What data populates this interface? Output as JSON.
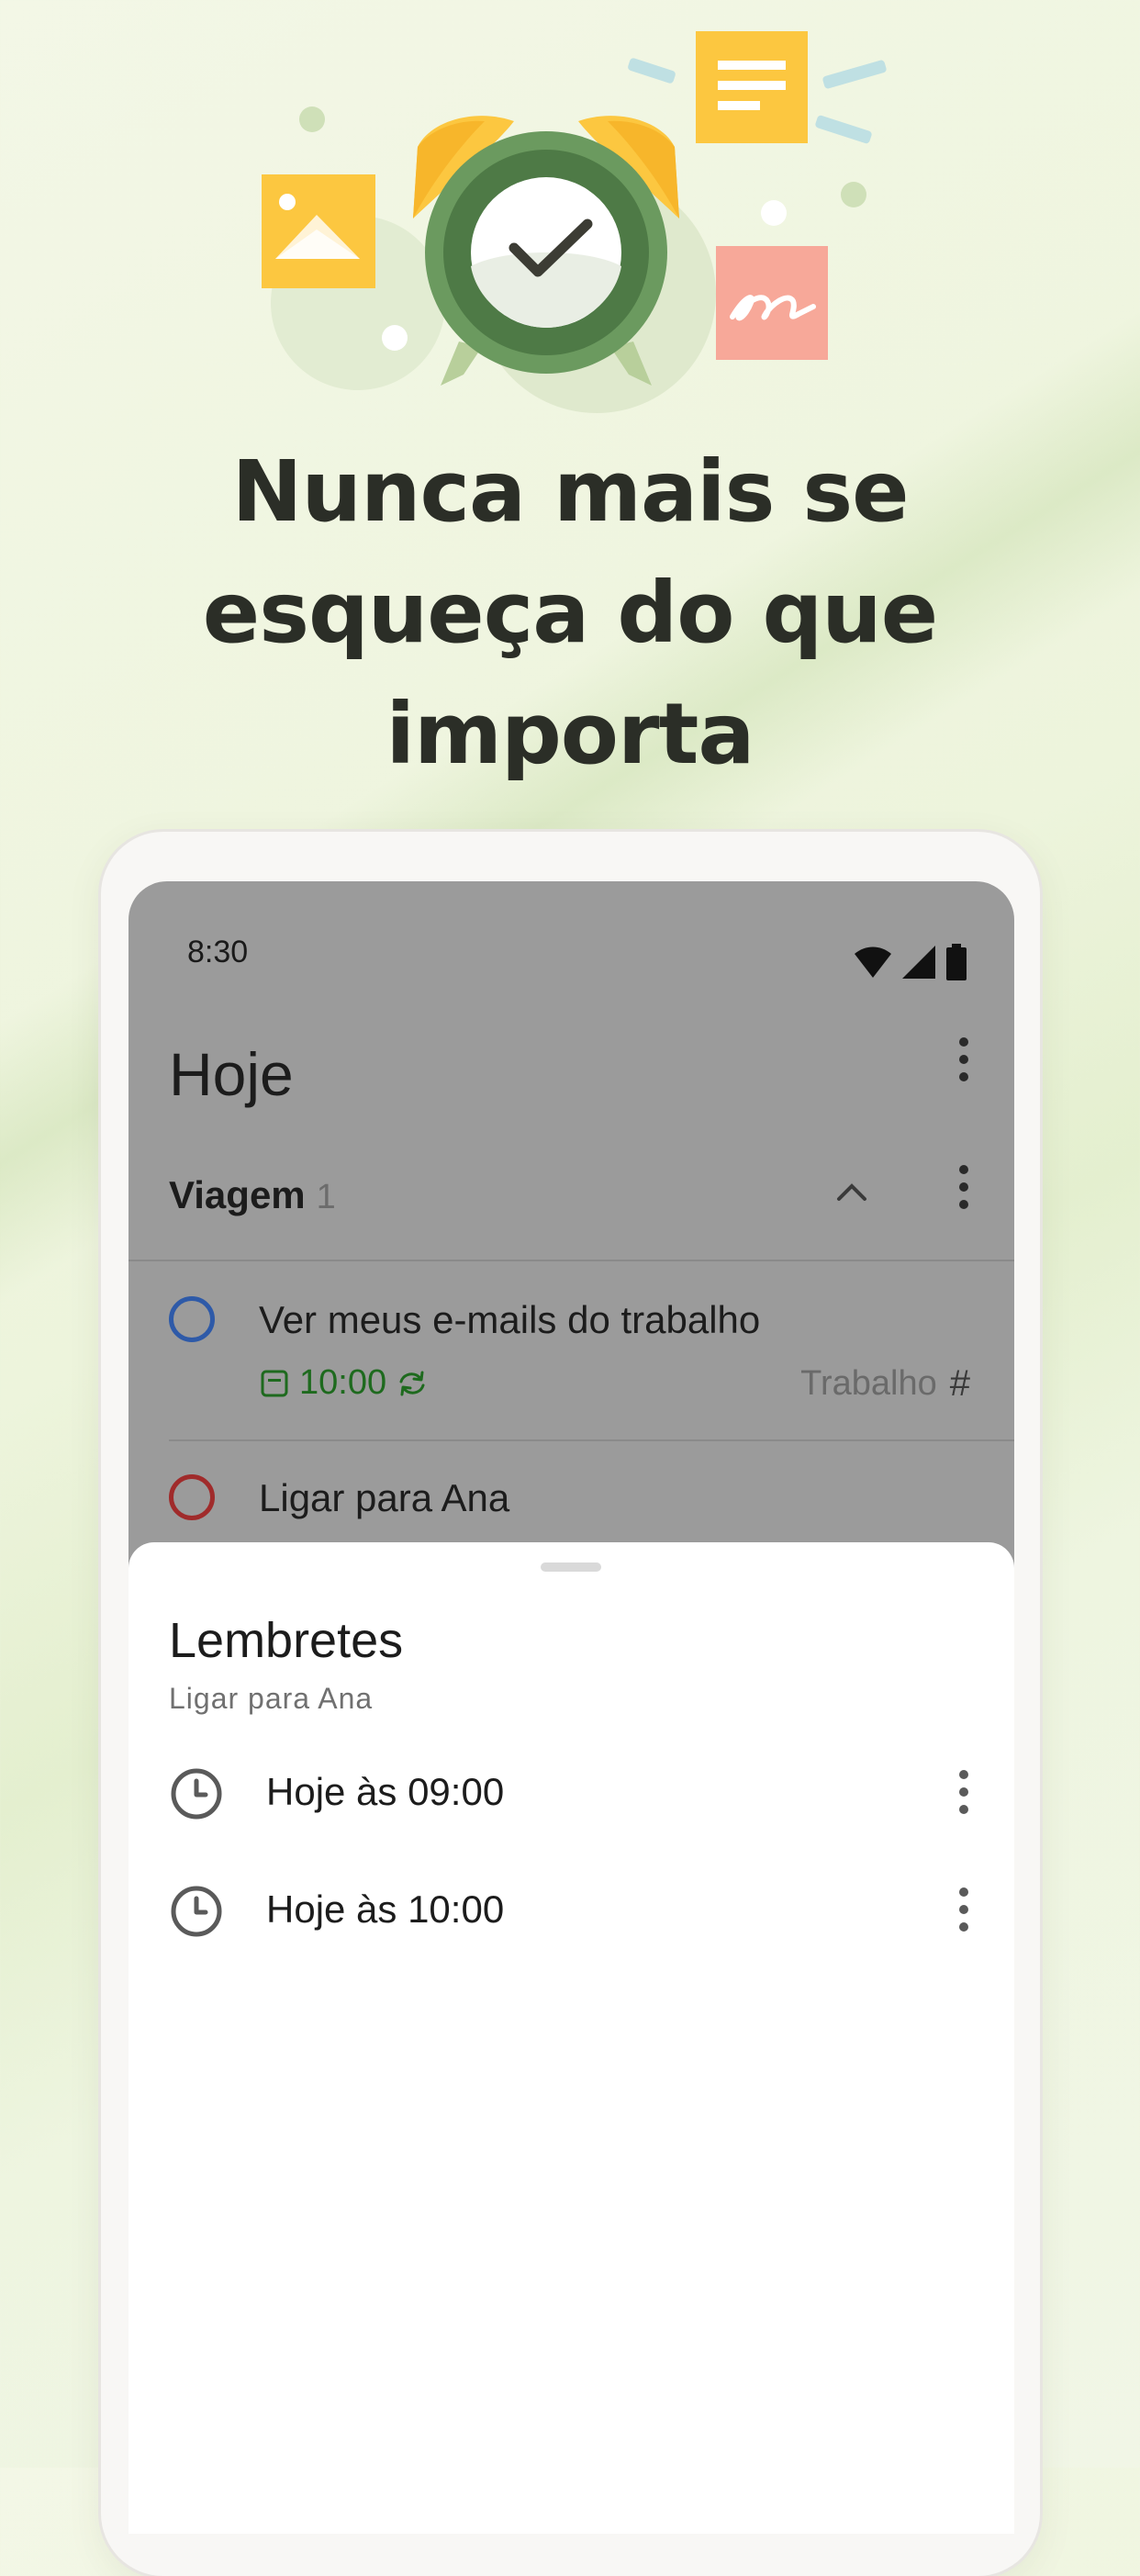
{
  "headline": {
    "line1": "Nunca mais se",
    "line2": "esqueça do que",
    "line3": "importa"
  },
  "status_bar": {
    "time": "8:30",
    "icons": [
      "wifi-icon",
      "signal-icon",
      "battery-icon"
    ]
  },
  "app": {
    "title": "Hoje",
    "section": {
      "name": "Viagem",
      "count": "1"
    },
    "tasks": [
      {
        "title": "Ver meus e-mails do trabalho",
        "priority_color": "#2e5aa8",
        "due_time": "10:00",
        "recurring": true,
        "project": "Trabalho"
      },
      {
        "title": "Ligar para Ana",
        "priority_color": "#a02b2b"
      }
    ]
  },
  "sheet": {
    "title": "Lembretes",
    "subtitle": "Ligar para Ana",
    "reminders": [
      {
        "label": "Hoje às 09:00"
      },
      {
        "label": "Hoje às 10:00"
      }
    ]
  },
  "colors": {
    "accent_green": "#1e6a1e",
    "clock_green": "#6b9a5f",
    "sticky_yellow": "#fcc740",
    "sticky_salmon": "#f7a899"
  }
}
